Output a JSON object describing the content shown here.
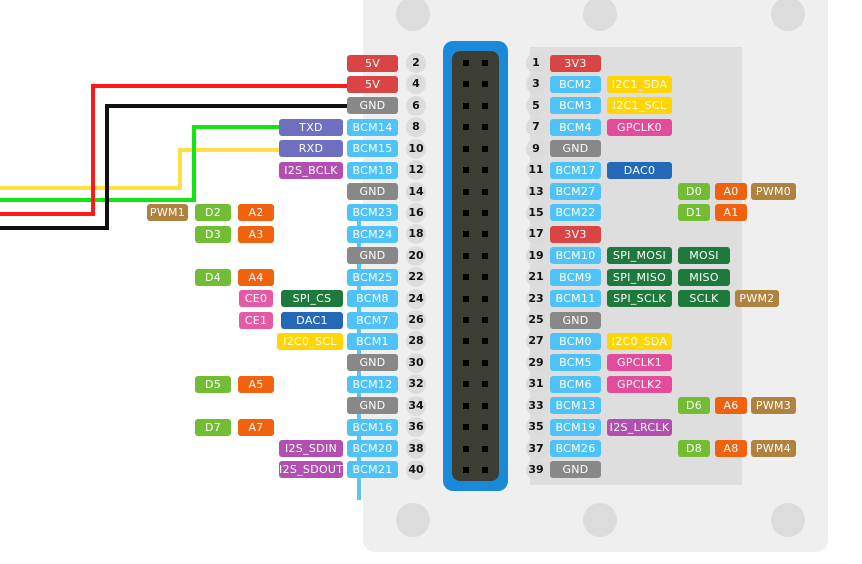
{
  "colors": {
    "power_5v": "#d94545",
    "power_3v3": "#d94545",
    "gnd": "#888888",
    "bcm": "#4fc3f7",
    "uart": "#6f6fc2",
    "i2s": "#b24fb0",
    "i2c": "#ffd600",
    "gpclk": "#e44b9a",
    "spi": "#1e7a3c",
    "dac": "#2469b8",
    "digital": "#72bd34",
    "analog": "#f0620d",
    "pwm": "#b0823f",
    "ce": "#e45aa4",
    "header_frame": "#1a8ad8",
    "wire_red": "#ff1a1a",
    "wire_black": "#111111",
    "wire_green": "#12e612",
    "wire_yellow": "#ffe040"
  },
  "wires": [
    {
      "color": "red",
      "to_pin": "4"
    },
    {
      "color": "black",
      "to_pin": "6"
    },
    {
      "color": "green",
      "to_pin": "8"
    },
    {
      "color": "yellow",
      "to_pin": "10"
    }
  ],
  "left_pins": [
    {
      "num": "2",
      "labels": [
        {
          "text": "5V",
          "type": "power_5v"
        }
      ]
    },
    {
      "num": "4",
      "labels": [
        {
          "text": "5V",
          "type": "power_5v"
        }
      ]
    },
    {
      "num": "6",
      "labels": [
        {
          "text": "GND",
          "type": "gnd"
        }
      ]
    },
    {
      "num": "8",
      "labels": [
        {
          "text": "BCM14",
          "type": "bcm"
        },
        {
          "text": "TXD",
          "type": "uart"
        }
      ]
    },
    {
      "num": "10",
      "labels": [
        {
          "text": "BCM15",
          "type": "bcm"
        },
        {
          "text": "RXD",
          "type": "uart"
        }
      ]
    },
    {
      "num": "12",
      "labels": [
        {
          "text": "BCM18",
          "type": "bcm"
        },
        {
          "text": "I2S_BCLK",
          "type": "i2s"
        }
      ]
    },
    {
      "num": "14",
      "labels": [
        {
          "text": "GND",
          "type": "gnd"
        }
      ]
    },
    {
      "num": "16",
      "labels": [
        {
          "text": "BCM23",
          "type": "bcm"
        }
      ],
      "extras": [
        {
          "text": "PWM1",
          "type": "pwm"
        },
        {
          "text": "D2",
          "type": "digital"
        },
        {
          "text": "A2",
          "type": "analog"
        }
      ]
    },
    {
      "num": "18",
      "labels": [
        {
          "text": "BCM24",
          "type": "bcm"
        }
      ],
      "extras": [
        {
          "text": "D3",
          "type": "digital"
        },
        {
          "text": "A3",
          "type": "analog"
        }
      ]
    },
    {
      "num": "20",
      "labels": [
        {
          "text": "GND",
          "type": "gnd"
        }
      ]
    },
    {
      "num": "22",
      "labels": [
        {
          "text": "BCM25",
          "type": "bcm"
        }
      ],
      "extras": [
        {
          "text": "D4",
          "type": "digital"
        },
        {
          "text": "A4",
          "type": "analog"
        }
      ]
    },
    {
      "num": "24",
      "labels": [
        {
          "text": "BCM8",
          "type": "bcm"
        },
        {
          "text": "SPI_CS",
          "type": "spi"
        },
        {
          "text": "CE0",
          "type": "ce"
        }
      ]
    },
    {
      "num": "26",
      "labels": [
        {
          "text": "BCM7",
          "type": "bcm"
        },
        {
          "text": "DAC1",
          "type": "dac"
        },
        {
          "text": "CE1",
          "type": "ce"
        }
      ]
    },
    {
      "num": "28",
      "labels": [
        {
          "text": "BCM1",
          "type": "bcm"
        },
        {
          "text": "I2C0_SCL",
          "type": "i2c"
        }
      ]
    },
    {
      "num": "30",
      "labels": [
        {
          "text": "GND",
          "type": "gnd"
        }
      ]
    },
    {
      "num": "32",
      "labels": [
        {
          "text": "BCM12",
          "type": "bcm"
        }
      ],
      "extras": [
        {
          "text": "D5",
          "type": "digital"
        },
        {
          "text": "A5",
          "type": "analog"
        }
      ]
    },
    {
      "num": "34",
      "labels": [
        {
          "text": "GND",
          "type": "gnd"
        }
      ]
    },
    {
      "num": "36",
      "labels": [
        {
          "text": "BCM16",
          "type": "bcm"
        }
      ],
      "extras": [
        {
          "text": "D7",
          "type": "digital"
        },
        {
          "text": "A7",
          "type": "analog"
        }
      ]
    },
    {
      "num": "38",
      "labels": [
        {
          "text": "BCM20",
          "type": "bcm"
        },
        {
          "text": "I2S_SDIN",
          "type": "i2s"
        }
      ]
    },
    {
      "num": "40",
      "labels": [
        {
          "text": "BCM21",
          "type": "bcm"
        },
        {
          "text": "I2S_SDOUT",
          "type": "i2s"
        }
      ]
    }
  ],
  "right_pins": [
    {
      "num": "1",
      "labels": [
        {
          "text": "3V3",
          "type": "power_3v3"
        }
      ]
    },
    {
      "num": "3",
      "labels": [
        {
          "text": "BCM2",
          "type": "bcm"
        },
        {
          "text": "I2C1_SDA",
          "type": "i2c"
        }
      ]
    },
    {
      "num": "5",
      "labels": [
        {
          "text": "BCM3",
          "type": "bcm"
        },
        {
          "text": "I2C1_SCL",
          "type": "i2c"
        }
      ]
    },
    {
      "num": "7",
      "labels": [
        {
          "text": "BCM4",
          "type": "bcm"
        },
        {
          "text": "GPCLK0",
          "type": "gpclk"
        }
      ]
    },
    {
      "num": "9",
      "labels": [
        {
          "text": "GND",
          "type": "gnd"
        }
      ]
    },
    {
      "num": "11",
      "labels": [
        {
          "text": "BCM17",
          "type": "bcm"
        },
        {
          "text": "DAC0",
          "type": "dac"
        }
      ]
    },
    {
      "num": "13",
      "labels": [
        {
          "text": "BCM27",
          "type": "bcm"
        }
      ],
      "extras": [
        {
          "text": "D0",
          "type": "digital"
        },
        {
          "text": "A0",
          "type": "analog"
        },
        {
          "text": "PWM0",
          "type": "pwm"
        }
      ]
    },
    {
      "num": "15",
      "labels": [
        {
          "text": "BCM22",
          "type": "bcm"
        }
      ],
      "extras": [
        {
          "text": "D1",
          "type": "digital"
        },
        {
          "text": "A1",
          "type": "analog"
        }
      ]
    },
    {
      "num": "17",
      "labels": [
        {
          "text": "3V3",
          "type": "power_3v3"
        }
      ]
    },
    {
      "num": "19",
      "labels": [
        {
          "text": "BCM10",
          "type": "bcm"
        },
        {
          "text": "SPI_MOSI",
          "type": "spi"
        },
        {
          "text": "MOSI",
          "type": "spi"
        }
      ]
    },
    {
      "num": "21",
      "labels": [
        {
          "text": "BCM9",
          "type": "bcm"
        },
        {
          "text": "SPI_MISO",
          "type": "spi"
        },
        {
          "text": "MISO",
          "type": "spi"
        }
      ]
    },
    {
      "num": "23",
      "labels": [
        {
          "text": "BCM11",
          "type": "bcm"
        },
        {
          "text": "SPI_SCLK",
          "type": "spi"
        },
        {
          "text": "SCLK",
          "type": "spi"
        },
        {
          "text": "PWM2",
          "type": "pwm"
        }
      ]
    },
    {
      "num": "25",
      "labels": [
        {
          "text": "GND",
          "type": "gnd"
        }
      ]
    },
    {
      "num": "27",
      "labels": [
        {
          "text": "BCM0",
          "type": "bcm"
        },
        {
          "text": "I2C0_SDA",
          "type": "i2c"
        }
      ]
    },
    {
      "num": "29",
      "labels": [
        {
          "text": "BCM5",
          "type": "bcm"
        },
        {
          "text": "GPCLK1",
          "type": "gpclk"
        }
      ]
    },
    {
      "num": "31",
      "labels": [
        {
          "text": "BCM6",
          "type": "bcm"
        },
        {
          "text": "GPCLK2",
          "type": "gpclk"
        }
      ]
    },
    {
      "num": "33",
      "labels": [
        {
          "text": "BCM13",
          "type": "bcm"
        }
      ],
      "extras": [
        {
          "text": "D6",
          "type": "digital"
        },
        {
          "text": "A6",
          "type": "analog"
        },
        {
          "text": "PWM3",
          "type": "pwm"
        }
      ]
    },
    {
      "num": "35",
      "labels": [
        {
          "text": "BCM19",
          "type": "bcm"
        },
        {
          "text": "I2S_LRCLK",
          "type": "i2s"
        }
      ]
    },
    {
      "num": "37",
      "labels": [
        {
          "text": "BCM26",
          "type": "bcm"
        }
      ],
      "extras": [
        {
          "text": "D8",
          "type": "digital"
        },
        {
          "text": "A8",
          "type": "analog"
        },
        {
          "text": "PWM4",
          "type": "pwm"
        }
      ]
    },
    {
      "num": "39",
      "labels": [
        {
          "text": "GND",
          "type": "gnd"
        }
      ]
    }
  ]
}
